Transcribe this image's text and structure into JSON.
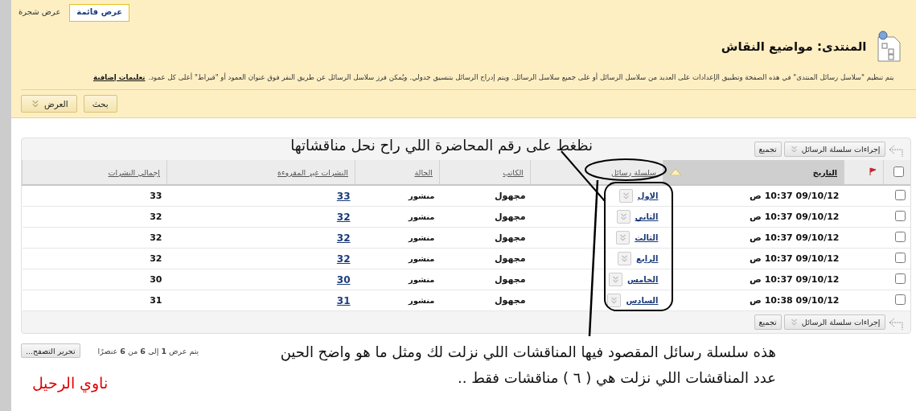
{
  "view_tabs": [
    {
      "label": "عرض قائمة",
      "selected": true
    },
    {
      "label": "عرض شجرة",
      "selected": false
    }
  ],
  "title": "المنتدى: مواضيع النقاش",
  "description": "يتم تنظيم \"سلاسل رسائل المنتدى\" في هذه الصفحة وتطبيق الإعدادات على العديد من سلاسل الرسائل أو على جميع سلاسل الرسائل. ويتم إدراج الرسائل بتنسيق جدولي. ويُمكن فرز سلاسل الرسائل عن طريق النقر فوق عنوان العمود أو \"قيراط\" أعلى كل عمود.",
  "help_link": "تعليمات إضافية",
  "action_buttons": [
    {
      "label": "بحث",
      "kind": "plain"
    },
    {
      "label": "العرض",
      "kind": "menu"
    }
  ],
  "table_toolbar_top": {
    "actions_menu": "إجراءات سلسلة الرسائل",
    "collect_button": "تجميع"
  },
  "columns": [
    {
      "label": "التاريخ",
      "sorted": true
    },
    {
      "label": "سلسلة رسائل",
      "sorted": false
    },
    {
      "label": "الكاتب",
      "sorted": false
    },
    {
      "label": "الحالة",
      "sorted": false
    },
    {
      "label": "النشرات غير المقروءة",
      "sorted": false
    },
    {
      "label": "إجمالي النشرات",
      "sorted": false
    }
  ],
  "header_checkbox": {
    "checked": false
  },
  "rows": [
    {
      "checked": false,
      "date": "09/10/12 10:37 ص",
      "thread": "الاول",
      "author": "مجهول",
      "status": "منشور",
      "unread": "33",
      "total": "33"
    },
    {
      "checked": false,
      "date": "09/10/12 10:37 ص",
      "thread": "الثاني",
      "author": "مجهول",
      "status": "منشور",
      "unread": "32",
      "total": "32"
    },
    {
      "checked": false,
      "date": "09/10/12 10:37 ص",
      "thread": "الثالث",
      "author": "مجهول",
      "status": "منشور",
      "unread": "32",
      "total": "32"
    },
    {
      "checked": false,
      "date": "09/10/12 10:37 ص",
      "thread": "الرابع",
      "author": "مجهول",
      "status": "منشور",
      "unread": "32",
      "total": "32"
    },
    {
      "checked": false,
      "date": "09/10/12 10:37 ص",
      "thread": "الخامس",
      "author": "مجهول",
      "status": "منشور",
      "unread": "30",
      "total": "30"
    },
    {
      "checked": false,
      "date": "09/10/12 10:38 ص",
      "thread": "السادس",
      "author": "مجهول",
      "status": "منشور",
      "unread": "31",
      "total": "31"
    }
  ],
  "table_toolbar_bottom": {
    "actions_menu": "إجراءات سلسلة الرسائل",
    "collect_button": "تجميع"
  },
  "paging_text": "يتم عرض **1** إلى **6** من **6** عنصرًا",
  "edit_paging_button": "تحرير التصفح...",
  "annotations": {
    "top_note": "نظغط على رقم المحاضرة اللي راح نحل مناقشاتها",
    "bottom_note": [
      "هذه سلسلة رسائل المقصود فيها المناقشات اللي نزلت لك ومثل ما هو واضح الحين",
      "عدد المناقشات اللي نزلت هي ( ٦ ) مناقشات فقط .."
    ],
    "signature": "ناوي الرحيل"
  }
}
